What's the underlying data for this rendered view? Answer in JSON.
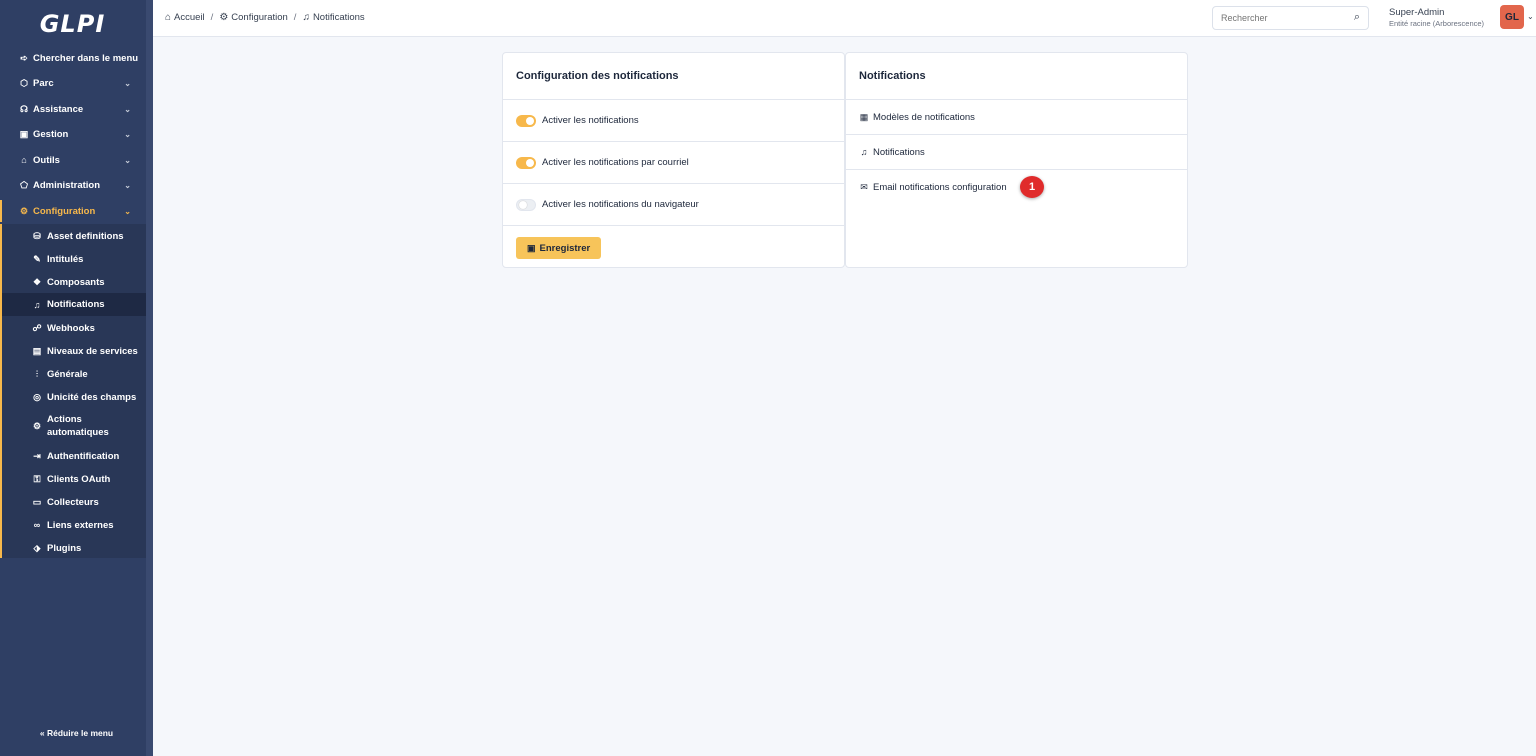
{
  "app": {
    "logo": "GLPI"
  },
  "sidebar": {
    "search_label": "Chercher dans le menu",
    "items": [
      {
        "label": "Parc",
        "icon": "box-icon"
      },
      {
        "label": "Assistance",
        "icon": "headset-icon"
      },
      {
        "label": "Gestion",
        "icon": "wallet-icon"
      },
      {
        "label": "Outils",
        "icon": "briefcase-icon"
      },
      {
        "label": "Administration",
        "icon": "shield-icon"
      },
      {
        "label": "Configuration",
        "icon": "gear-icon"
      }
    ],
    "subitems": [
      {
        "label": "Asset definitions",
        "icon": "database-icon"
      },
      {
        "label": "Intitulés",
        "icon": "edit-icon"
      },
      {
        "label": "Composants",
        "icon": "components-icon"
      },
      {
        "label": "Notifications",
        "icon": "bell-icon"
      },
      {
        "label": "Webhooks",
        "icon": "webhook-icon"
      },
      {
        "label": "Niveaux de services",
        "icon": "clipboard-icon"
      },
      {
        "label": "Générale",
        "icon": "sliders-icon"
      },
      {
        "label": "Unicité des champs",
        "icon": "fingerprint-icon"
      },
      {
        "label": "Actions automatiques",
        "icon": "settings-automation-icon"
      },
      {
        "label": "Authentification",
        "icon": "login-icon"
      },
      {
        "label": "Clients OAuth",
        "icon": "key-icon"
      },
      {
        "label": "Collecteurs",
        "icon": "inbox-icon"
      },
      {
        "label": "Liens externes",
        "icon": "link-icon"
      },
      {
        "label": "Plugins",
        "icon": "puzzle-icon"
      }
    ],
    "collapse_label": "Réduire le menu"
  },
  "header": {
    "breadcrumb": [
      "Accueil",
      "Configuration",
      "Notifications"
    ],
    "search_placeholder": "Rechercher",
    "user_name": "Super-Admin",
    "user_entity": "Entité racine (Arborescence)",
    "avatar_initials": "GL"
  },
  "config_card": {
    "title": "Configuration des notifications",
    "toggles": [
      {
        "label": "Activer les notifications",
        "on": true
      },
      {
        "label": "Activer les notifications par courriel",
        "on": true
      },
      {
        "label": "Activer les notifications du navigateur",
        "on": false
      }
    ],
    "save_label": "Enregistrer"
  },
  "notif_card": {
    "title": "Notifications",
    "links": [
      {
        "label": "Modèles de notifications",
        "icon": "template-icon"
      },
      {
        "label": "Notifications",
        "icon": "bell-icon"
      },
      {
        "label": "Email notifications configuration",
        "icon": "mail-icon"
      }
    ],
    "marker": "1"
  },
  "colors": {
    "accent": "#f7b84b",
    "sidebar": "#2f3f64",
    "marker": "#e02b2b",
    "avatar": "#e2664c"
  }
}
